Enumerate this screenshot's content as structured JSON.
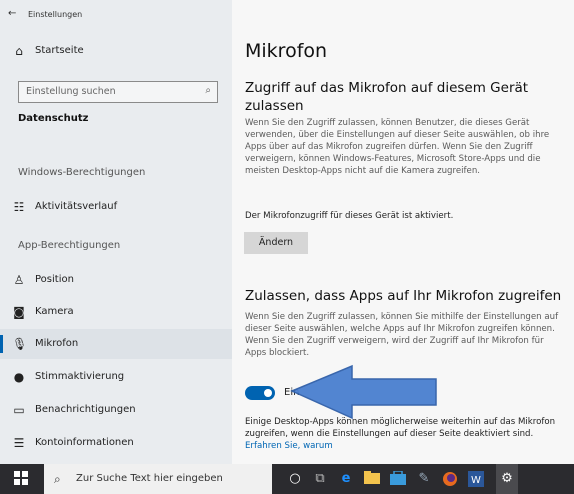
{
  "window": {
    "title": "Einstellungen"
  },
  "sidebar": {
    "home": "Startseite",
    "search_placeholder": "Einstellung suchen",
    "category": "Datenschutz",
    "group1": "Windows-Berechtigungen",
    "items1": [
      {
        "label": "Aktivitätsverlauf",
        "icon": "activity-icon"
      }
    ],
    "group2": "App-Berechtigungen",
    "items2": [
      {
        "label": "Position",
        "icon": "location-icon"
      },
      {
        "label": "Kamera",
        "icon": "camera-icon"
      },
      {
        "label": "Mikrofon",
        "icon": "microphone-icon"
      },
      {
        "label": "Stimmaktivierung",
        "icon": "voice-icon"
      },
      {
        "label": "Benachrichtigungen",
        "icon": "notification-icon"
      },
      {
        "label": "Kontoinformationen",
        "icon": "account-info-icon"
      }
    ]
  },
  "main": {
    "title": "Mikrofon",
    "section1": {
      "heading": "Zugriff auf das Mikrofon auf diesem Gerät zulassen",
      "body": "Wenn Sie den Zugriff zulassen, können Benutzer, die dieses Gerät verwenden, über die Einstellungen auf dieser Seite auswählen, ob ihre Apps über auf das Mikrofon zugreifen dürfen. Wenn Sie den Zugriff verweigern, können Windows-Features, Microsoft Store-Apps und die meisten Desktop-Apps nicht auf die Kamera zugreifen.",
      "status": "Der Mikrofonzugriff für dieses Gerät ist aktiviert.",
      "button": "Ändern"
    },
    "section2": {
      "heading": "Zulassen, dass Apps auf Ihr Mikrofon zugreifen",
      "body": "Wenn Sie den Zugriff zulassen, können Sie mithilfe der Einstellungen auf dieser Seite auswählen, welche Apps auf Ihr Mikrofon zugreifen können. Wenn Sie den Zugriff verweigern, wird der Zugriff auf Ihr Mikrofon für Apps blockiert.",
      "toggle_label": "Ein",
      "toggle_on": true,
      "note": "Einige Desktop-Apps können möglicherweise weiterhin auf das Mikrofon zugreifen, wenn die Einstellungen auf dieser Seite deaktiviert sind.",
      "link": "Erfahren Sie, warum"
    }
  },
  "taskbar": {
    "search_placeholder": "Zur Suche Text hier eingeben"
  },
  "colors": {
    "accent": "#0063b1",
    "arrow": "#4a7fd0",
    "taskbar": "#2b2b2f"
  }
}
